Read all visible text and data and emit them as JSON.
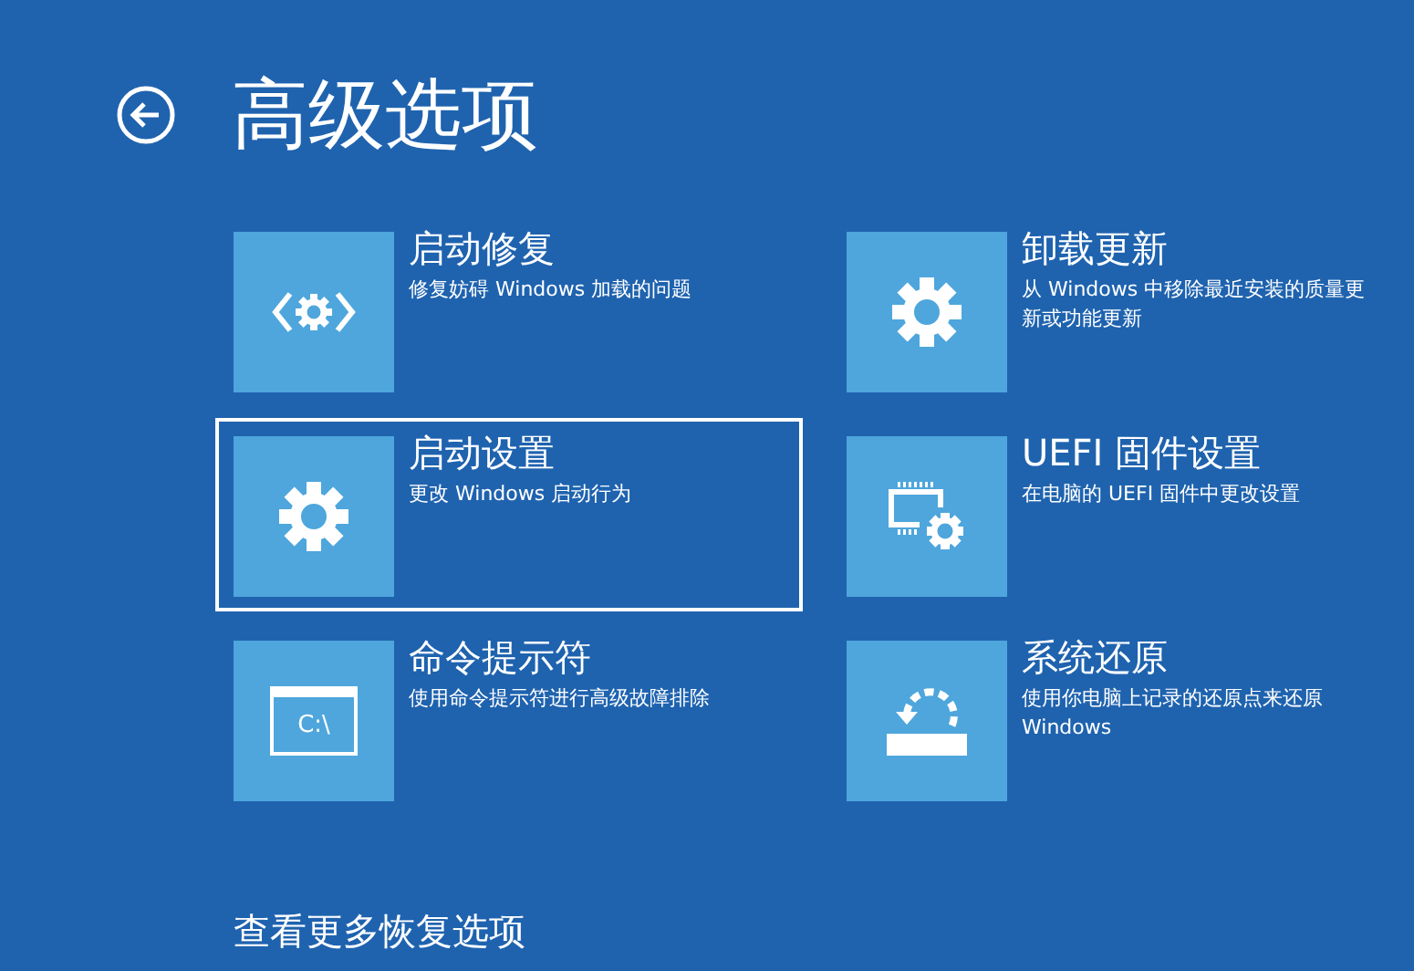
{
  "title": "高级选项",
  "options": [
    {
      "title": "启动修复",
      "description": "修复妨碍 Windows 加载的问题",
      "kind": "repair",
      "selected": false
    },
    {
      "title": "卸载更新",
      "description": "从 Windows 中移除最近安装的质量更新或功能更新",
      "kind": "gear",
      "selected": false
    },
    {
      "title": "启动设置",
      "description": "更改 Windows 启动行为",
      "kind": "gear",
      "selected": true
    },
    {
      "title": "UEFI 固件设置",
      "description": "在电脑的 UEFI 固件中更改设置",
      "kind": "firmware",
      "selected": false
    },
    {
      "title": "命令提示符",
      "description": "使用命令提示符进行高级故障排除",
      "kind": "terminal",
      "icon_text": "C:\\",
      "selected": false
    },
    {
      "title": "系统还原",
      "description": "使用你电脑上记录的还原点来还原 Windows",
      "kind": "restore",
      "selected": false
    }
  ],
  "more_link": "查看更多恢复选项"
}
